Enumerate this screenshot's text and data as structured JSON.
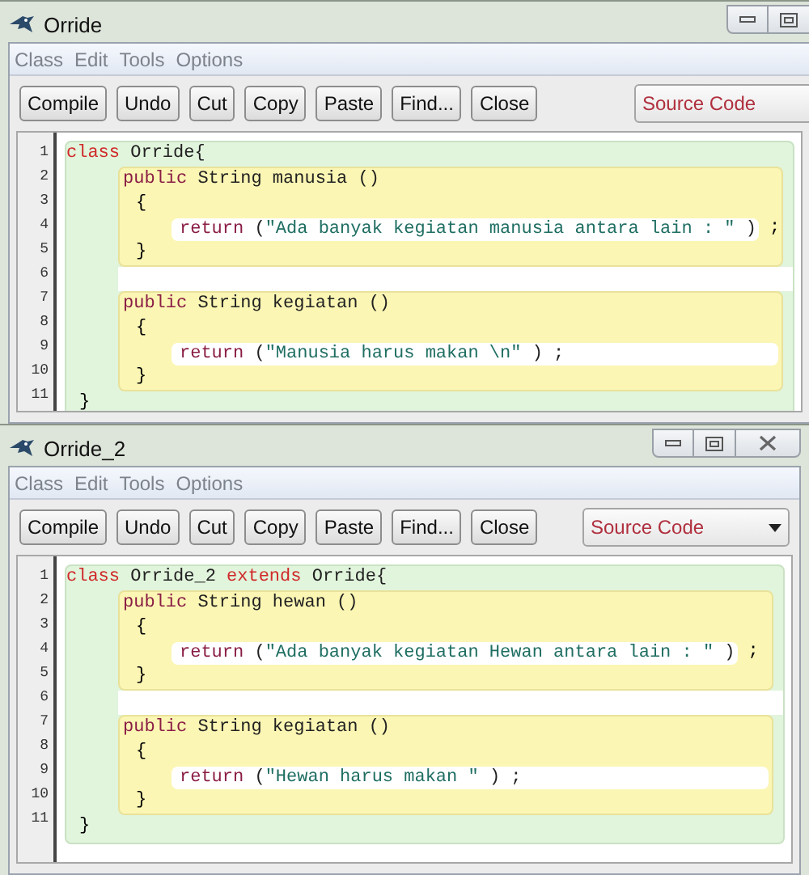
{
  "windows": [
    {
      "title": "Orride",
      "title_buttons": [
        {
          "kind": "minimize"
        },
        {
          "kind": "maximize"
        }
      ],
      "menu": [
        "Class",
        "Edit",
        "Tools",
        "Options"
      ],
      "buttons": [
        "Compile",
        "Undo",
        "Cut",
        "Copy",
        "Paste",
        "Find...",
        "Close"
      ],
      "view_selector": {
        "value": "Source Code",
        "show_caret": false
      },
      "line_numbers": [
        "1",
        "2",
        "3",
        "4",
        "5",
        "6",
        "7",
        "8",
        "9",
        "10",
        "11"
      ],
      "code": {
        "class_header": [
          {
            "kind": "keyword",
            "text": "class"
          },
          {
            "kind": "plain",
            "text": " Orride{"
          }
        ],
        "methods": [
          {
            "header": [
              {
                "kind": "modifier",
                "text": "public"
              },
              {
                "kind": "plain",
                "text": " String manusia ()"
              }
            ],
            "open": "{",
            "statement": [
              {
                "kind": "modifier",
                "text": "return"
              },
              {
                "kind": "plain",
                "text": " ("
              },
              {
                "kind": "string",
                "text": "\"Ada banyak kegiatan manusia antara lain : \""
              },
              {
                "kind": "plain",
                "text": " )"
              }
            ],
            "trailing": ";",
            "close": "}"
          },
          {
            "header": [
              {
                "kind": "modifier",
                "text": "public"
              },
              {
                "kind": "plain",
                "text": " String kegiatan ()"
              }
            ],
            "open": "{",
            "statement": [
              {
                "kind": "modifier",
                "text": "return"
              },
              {
                "kind": "plain",
                "text": " ("
              },
              {
                "kind": "string",
                "text": "\"Manusia harus makan \\n\""
              },
              {
                "kind": "plain",
                "text": " ) ;"
              }
            ],
            "close": "}"
          }
        ],
        "class_close": "}"
      }
    },
    {
      "title": "Orride_2",
      "title_buttons": [
        {
          "kind": "minimize"
        },
        {
          "kind": "maximize"
        },
        {
          "kind": "close"
        }
      ],
      "menu": [
        "Class",
        "Edit",
        "Tools",
        "Options"
      ],
      "buttons": [
        "Compile",
        "Undo",
        "Cut",
        "Copy",
        "Paste",
        "Find...",
        "Close"
      ],
      "view_selector": {
        "value": "Source Code",
        "show_caret": true
      },
      "line_numbers": [
        "1",
        "2",
        "3",
        "4",
        "5",
        "6",
        "7",
        "8",
        "9",
        "10",
        "11"
      ],
      "code": {
        "class_header": [
          {
            "kind": "keyword",
            "text": "class"
          },
          {
            "kind": "plain",
            "text": " Orride_2 "
          },
          {
            "kind": "keyword",
            "text": "extends"
          },
          {
            "kind": "plain",
            "text": " Orride{"
          }
        ],
        "methods": [
          {
            "header": [
              {
                "kind": "modifier",
                "text": "public"
              },
              {
                "kind": "plain",
                "text": " String hewan ()"
              }
            ],
            "open": "{",
            "statement": [
              {
                "kind": "modifier",
                "text": "return"
              },
              {
                "kind": "plain",
                "text": " ("
              },
              {
                "kind": "string",
                "text": "\"Ada banyak kegiatan Hewan antara lain : \""
              },
              {
                "kind": "plain",
                "text": " )"
              }
            ],
            "trailing": ";",
            "close": "}"
          },
          {
            "header": [
              {
                "kind": "modifier",
                "text": "public"
              },
              {
                "kind": "plain",
                "text": " String kegiatan ()"
              }
            ],
            "open": "{",
            "statement": [
              {
                "kind": "modifier",
                "text": "return"
              },
              {
                "kind": "plain",
                "text": " ("
              },
              {
                "kind": "string",
                "text": "\"Hewan harus makan \""
              },
              {
                "kind": "plain",
                "text": " ) ;"
              }
            ],
            "close": "}"
          }
        ],
        "class_close": "}"
      }
    }
  ]
}
